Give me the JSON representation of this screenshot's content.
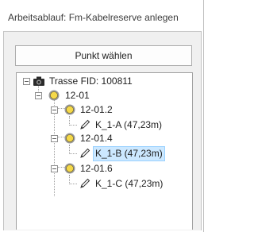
{
  "header": {
    "title": "Arbeitsablauf: Fm-Kabelreserve anlegen"
  },
  "toolbar": {
    "select_point_label": "Punkt wählen"
  },
  "tree": {
    "root": {
      "label": "Trasse FID: 100811",
      "icon": "camera-icon"
    },
    "group": {
      "label": "12-01",
      "icon": "point-icon"
    },
    "children": [
      {
        "label": "12-01.2",
        "icon": "point-icon",
        "leaf": {
          "label": "K_1-A (47,23m)",
          "icon": "pencil-icon",
          "selected": false
        }
      },
      {
        "label": "12-01.4",
        "icon": "point-icon",
        "leaf": {
          "label": "K_1-B (47,23m)",
          "icon": "pencil-icon",
          "selected": true
        }
      },
      {
        "label": "12-01.6",
        "icon": "point-icon",
        "leaf": {
          "label": "K_1-C (47,23m)",
          "icon": "pencil-icon",
          "selected": false
        }
      }
    ]
  },
  "colors": {
    "selection": "#cce8ff",
    "point_fill": "#f5d94a",
    "point_ring": "#8a8a8a"
  }
}
